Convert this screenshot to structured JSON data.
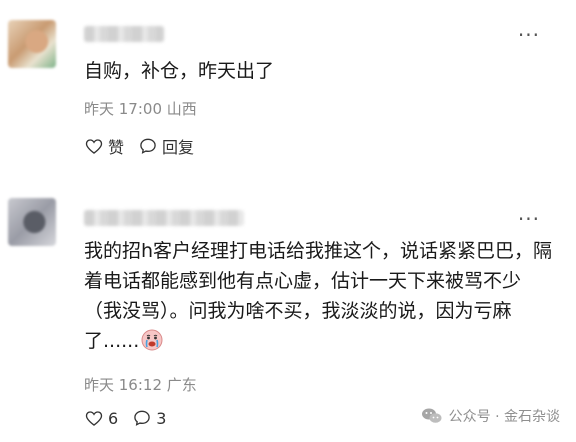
{
  "comments": [
    {
      "text": "自购，补仓，昨天出了",
      "time": "昨天 17:00",
      "location": "山西",
      "like_label": "赞",
      "reply_label": "回复"
    },
    {
      "text": "我的招h客户经理打电话给我推这个，说话紧紧巴巴，隔着电话都能感到他有点心虚，估计一天下来被骂不少（我没骂）。问我为啥不买，我淡淡的说，因为亏麻了......",
      "time": "昨天 16:12",
      "location": "广东",
      "like_count": "6",
      "reply_count": "3"
    }
  ],
  "watermark": "公众号 · 金石杂谈",
  "icons": {
    "more": "more-icon",
    "like": "thumb-up-icon",
    "reply": "comment-bubble-icon",
    "emoji": "crying-face-emoji",
    "wechat": "wechat-icon"
  }
}
